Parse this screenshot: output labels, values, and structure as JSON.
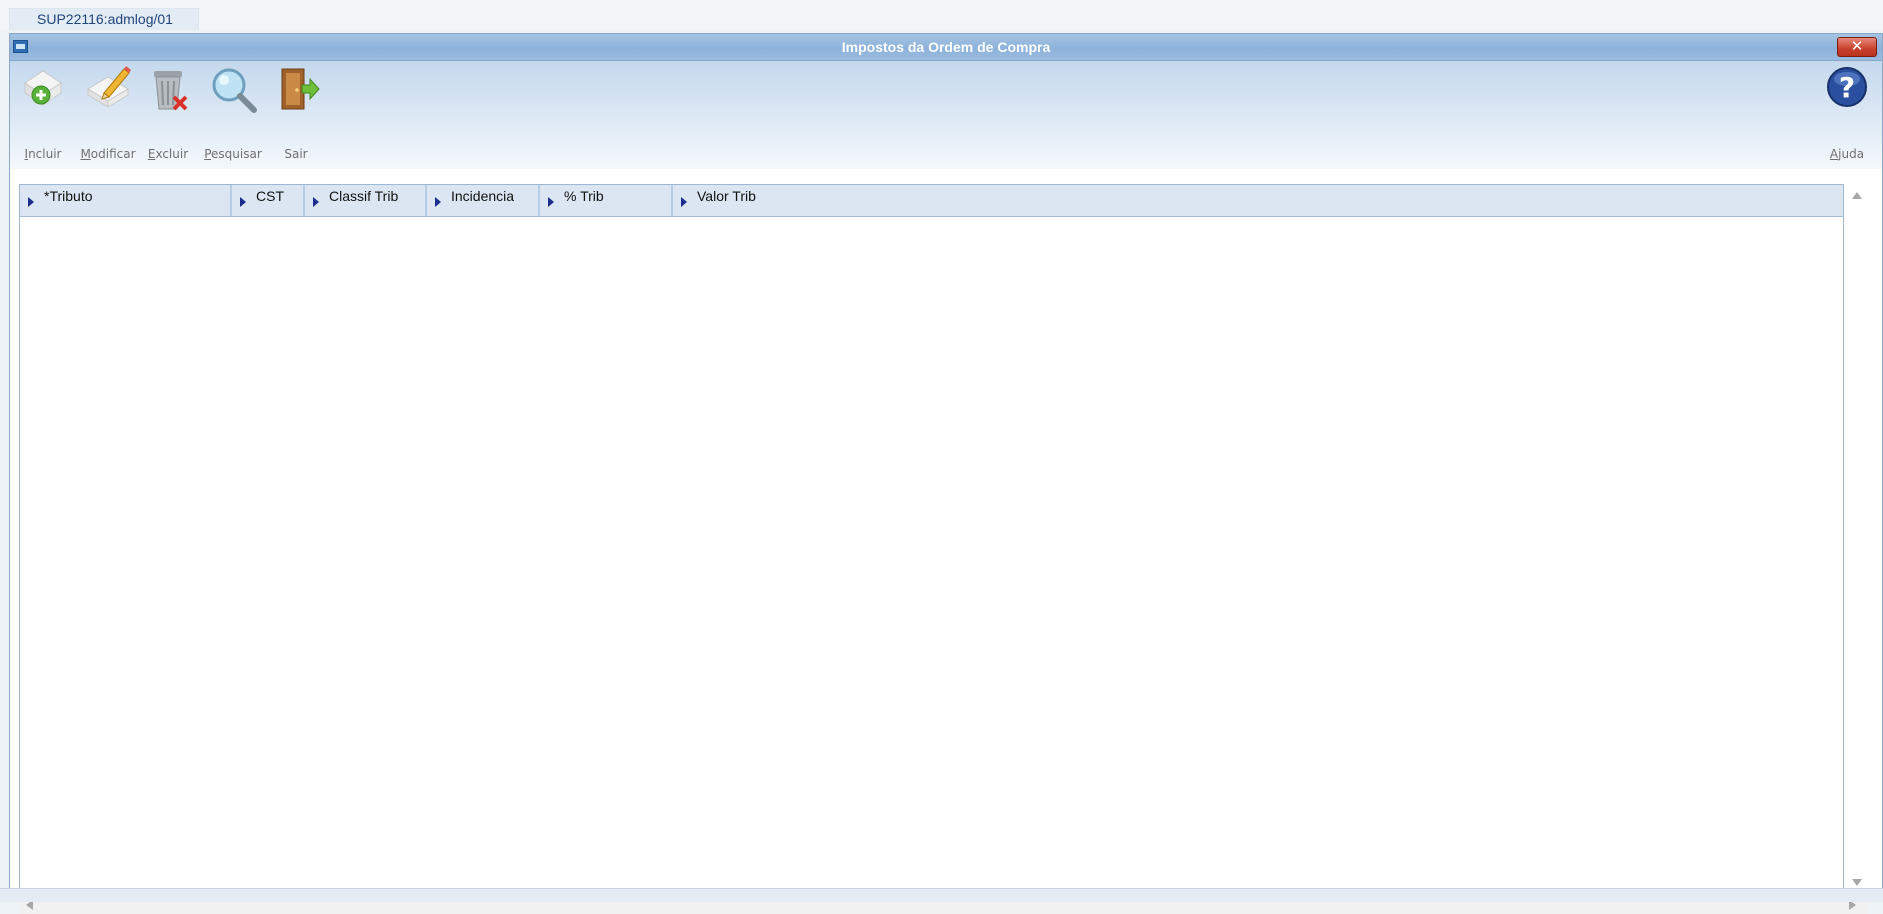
{
  "tab": {
    "label": "SUP22116:admlog/01"
  },
  "window": {
    "title": "Impostos da Ordem de Compra",
    "close_glyph": "✕"
  },
  "toolbar": {
    "incluir": {
      "mnemonic": "I",
      "rest": "ncluir"
    },
    "modificar": {
      "mnemonic": "M",
      "rest": "odificar"
    },
    "excluir": {
      "mnemonic": "E",
      "rest": "xcluir"
    },
    "pesquisar": {
      "mnemonic": "P",
      "rest": "esquisar"
    },
    "sair": {
      "label": "Sair"
    },
    "ajuda": {
      "mnemonic": "A",
      "rest": "juda"
    }
  },
  "grid": {
    "columns": [
      "*Tributo",
      "CST",
      "Classif Trib",
      "Incidencia",
      "% Trib",
      "Valor Trib"
    ],
    "rows": []
  },
  "icons": {
    "incluir": "add-document-icon",
    "modificar": "edit-pencil-icon",
    "excluir": "trash-can-icon",
    "pesquisar": "magnifier-icon",
    "sair": "exit-door-icon",
    "ajuda": "help-icon"
  },
  "colors": {
    "titlebar": "#8db2da",
    "close_button": "#c8402c",
    "header_bg": "#dbe6f2",
    "sort_arrow": "#1b2c8c"
  }
}
